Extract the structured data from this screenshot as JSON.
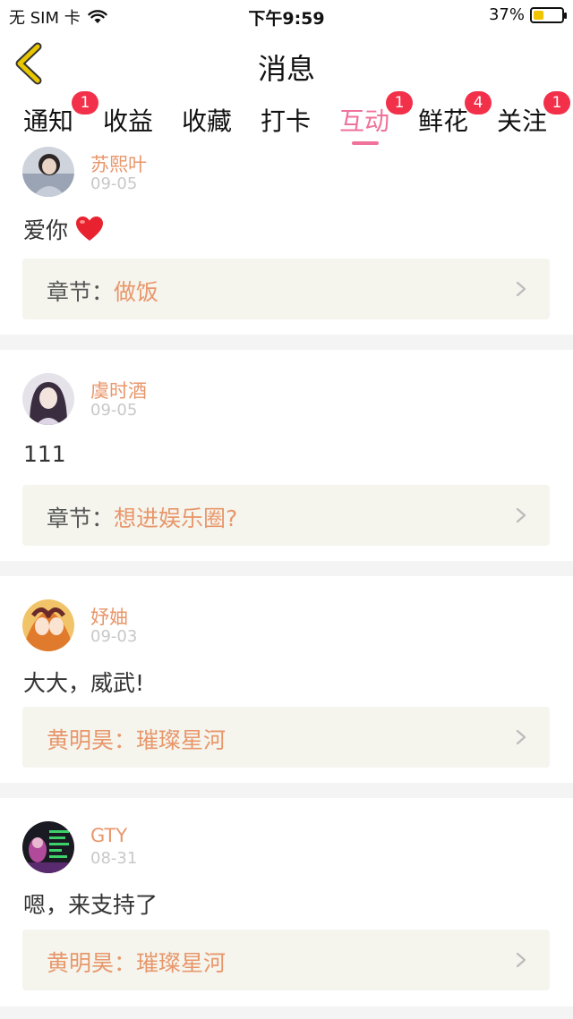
{
  "status_bar": {
    "carrier": "无 SIM 卡",
    "time": "下午9:59",
    "battery": "37%",
    "battery_level": 0.37
  },
  "nav": {
    "title": "消息"
  },
  "tabs": [
    {
      "label": "通知",
      "badge": "1"
    },
    {
      "label": "收益",
      "badge": ""
    },
    {
      "label": "收藏",
      "badge": ""
    },
    {
      "label": "打卡",
      "badge": ""
    },
    {
      "label": "互动",
      "badge": "1",
      "active": true
    },
    {
      "label": "鲜花",
      "badge": "4"
    },
    {
      "label": "关注",
      "badge": "1"
    }
  ],
  "messages": [
    {
      "user": "苏熙叶",
      "date": "09-05",
      "text": "爱你",
      "emoji": "❤️",
      "ref_prefix": "章节：",
      "ref_title": "做饭"
    },
    {
      "user": "虞时酒",
      "date": "09-05",
      "text": "111",
      "emoji": "",
      "ref_prefix": "章节：",
      "ref_title": "想进娱乐圈?"
    },
    {
      "user": "妤妯",
      "date": "09-03",
      "text": "大大，威武!",
      "emoji": "",
      "ref_prefix": "黄明昊：",
      "ref_title": "璀璨星河"
    },
    {
      "user": "GTY",
      "date": "08-31",
      "text": "嗯，来支持了",
      "emoji": "",
      "ref_prefix": "黄明昊：",
      "ref_title": "璀璨星河"
    }
  ],
  "colors": {
    "accent_pink": "#f0729a",
    "orange_text": "#e8976b",
    "badge_red": "#f3304a",
    "back_yellow": "#e8c600"
  }
}
